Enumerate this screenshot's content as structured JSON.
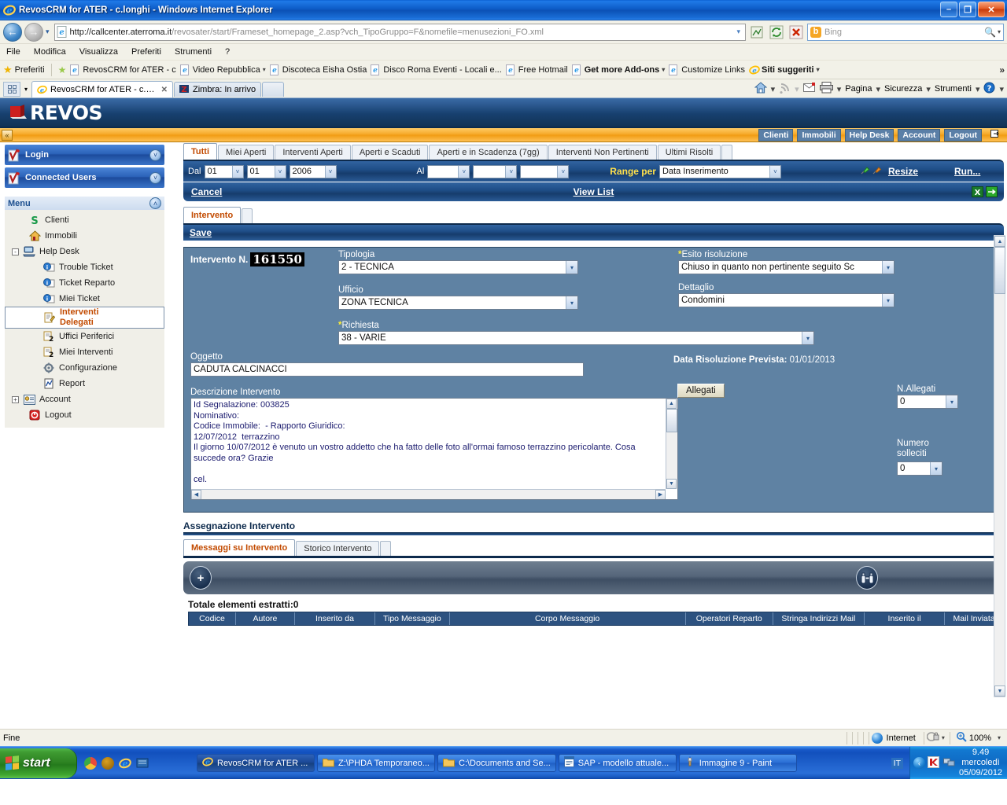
{
  "window": {
    "title": "RevosCRM for ATER - c.longhi - Windows Internet Explorer",
    "minimize": "–",
    "maximize": "❐",
    "close": "✕"
  },
  "address": {
    "back_icon": "←",
    "forward_icon": "→",
    "history_caret": "▾",
    "url_bold": "http://callcenter.aterroma.it",
    "url_rest": "/revosater/start/Frameset_homepage_2.asp?vch_TipoGruppo=F&nomefile=menusezioni_FO.xml",
    "url_caret": "▾",
    "compat_icon": "compatibility-view-icon",
    "refresh_icon": "↻",
    "stop_icon": "✕",
    "search_engine": "Bing",
    "search_placeholder": "Bing",
    "search_icon": "🔍",
    "search_caret": "▾"
  },
  "menubar": [
    "File",
    "Modifica",
    "Visualizza",
    "Preferiti",
    "Strumenti",
    "?"
  ],
  "favbar": {
    "label": "Preferiti",
    "items": [
      {
        "label": "RevosCRM for ATER - c",
        "caret": false,
        "bold": false
      },
      {
        "label": "Video Repubblica",
        "caret": true,
        "bold": false
      },
      {
        "label": "Discoteca Eisha Ostia",
        "caret": false,
        "bold": false
      },
      {
        "label": "Disco Roma Eventi - Locali e...",
        "caret": false,
        "bold": false
      },
      {
        "label": "Free Hotmail",
        "caret": false,
        "bold": false
      },
      {
        "label": "Get more Add-ons",
        "caret": true,
        "bold": true
      },
      {
        "label": "Customize Links",
        "caret": false,
        "bold": false
      },
      {
        "label": "Siti suggeriti",
        "caret": true,
        "bold": true
      }
    ],
    "overflow": "»"
  },
  "browser_tabs": {
    "quicktabs_caret": "▾",
    "tabs": [
      {
        "label": "RevosCRM for ATER - c.l...",
        "active": true,
        "close": "✕"
      },
      {
        "label": "Zimbra: In arrivo",
        "active": false,
        "close": ""
      }
    ],
    "command_bar": [
      "Pagina",
      "Sicurezza",
      "Strumenti"
    ],
    "overflow": "»"
  },
  "app": {
    "brand": "REVOS",
    "collapse_icon": "«",
    "topnav": [
      "Clienti",
      "Immobili",
      "Help Desk",
      "Account",
      "Logout"
    ]
  },
  "sidebar": {
    "panels": [
      {
        "title": "Login",
        "toggle": "˅"
      },
      {
        "title": "Connected Users",
        "toggle": "˅"
      }
    ],
    "menu_title": "Menu",
    "menu_toggle": "˄",
    "items": [
      {
        "label": "Clienti",
        "icon": "clienti-icon",
        "indent": 1,
        "expander": "",
        "selected": false
      },
      {
        "label": "Immobili",
        "icon": "immobili-icon",
        "indent": 1,
        "expander": "",
        "selected": false
      },
      {
        "label": "Help Desk",
        "icon": "helpdesk-icon",
        "indent": 0,
        "expander": "-",
        "selected": false
      },
      {
        "label": "Trouble Ticket",
        "icon": "ticket-icon",
        "indent": 2,
        "expander": "",
        "selected": false
      },
      {
        "label": "Ticket Reparto",
        "icon": "ticket-icon",
        "indent": 2,
        "expander": "",
        "selected": false
      },
      {
        "label": "Miei Ticket",
        "icon": "ticket-icon",
        "indent": 2,
        "expander": "",
        "selected": false
      },
      {
        "label": "Interventi Delegati",
        "icon": "interventi-icon",
        "indent": 2,
        "expander": "",
        "selected": true
      },
      {
        "label": "Uffici Periferici",
        "icon": "uffici-icon",
        "indent": 2,
        "expander": "",
        "selected": false
      },
      {
        "label": "Miei Interventi",
        "icon": "uffici-icon",
        "indent": 2,
        "expander": "",
        "selected": false
      },
      {
        "label": "Configurazione",
        "icon": "gear-icon",
        "indent": 2,
        "expander": "",
        "selected": false
      },
      {
        "label": "Report",
        "icon": "report-icon",
        "indent": 2,
        "expander": "",
        "selected": false
      },
      {
        "label": "Account",
        "icon": "account-icon",
        "indent": 0,
        "expander": "+",
        "selected": false
      },
      {
        "label": "Logout",
        "icon": "logout-icon",
        "indent": 1,
        "expander": "",
        "selected": false
      }
    ]
  },
  "filter_tabs": [
    {
      "label": "Tutti",
      "active": true
    },
    {
      "label": "Miei Aperti",
      "active": false
    },
    {
      "label": "Interventi Aperti",
      "active": false
    },
    {
      "label": "Aperti e Scaduti",
      "active": false
    },
    {
      "label": "Aperti e in Scadenza (7gg)",
      "active": false
    },
    {
      "label": "Interventi Non Pertinenti",
      "active": false
    },
    {
      "label": "Ultimi Risolti",
      "active": false
    }
  ],
  "filter_bar": {
    "dal_label": "Dal",
    "dal_day": "01",
    "dal_month": "01",
    "dal_year": "2006",
    "al_label": "Al",
    "al_day": "",
    "al_month": "",
    "al_year": "",
    "range_label": "Range per",
    "range_value": "Data Inserimento",
    "resize_label": "Resize",
    "run_label": "Run...",
    "caret": "˅"
  },
  "action_bar": {
    "cancel_label": "Cancel",
    "view_list_label": "View List",
    "excel_icon": "excel-export-icon",
    "arrow_icon": "→"
  },
  "form": {
    "tab_label": "Intervento",
    "save_label": "Save",
    "intervento_label": "Intervento N.",
    "intervento_number": "161550",
    "tipologia_label": "Tipologia",
    "tipologia_value": "2 - TECNICA",
    "ufficio_label": "Ufficio",
    "ufficio_value": "ZONA TECNICA",
    "richiesta_label": "Richiesta",
    "richiesta_value": "38 - VARIE",
    "esito_label": "Esito risoluzione",
    "esito_value": "Chiuso in quanto non pertinente seguito Sc",
    "dettaglio_label": "Dettaglio",
    "dettaglio_value": "Condomini",
    "data_risoluzione_label": "Data Risoluzione Prevista:",
    "data_risoluzione_value": "01/01/2013",
    "oggetto_label": "Oggetto",
    "oggetto_value": "CADUTA CALCINACCI",
    "descrizione_label": "Descrizione Intervento",
    "descrizione_value": "Id Segnalazione: 003825\nNominativo:\nCodice Immobile:  - Rapporto Giuridico:\n12/07/2012  terrazzino\nIl giorno 10/07/2012 è venuto un vostro addetto che ha fatto delle foto all'ormai famoso terrazzino pericolante. Cosa succede ora? Grazie\n\ncel.",
    "allegati_button": "Allegati",
    "n_allegati_label": "N.Allegati",
    "n_allegati_value": "0",
    "numero_solleciti_label": "Numero solleciti",
    "numero_solleciti_value": "0",
    "required_marker": "*"
  },
  "assignment": {
    "title": "Assegnazione Intervento",
    "tabs": [
      {
        "label": "Messaggi su Intervento",
        "active": true
      },
      {
        "label": "Storico Intervento",
        "active": false
      }
    ],
    "add_button": "+",
    "tool_button": "binoculars-icon",
    "total_label": "Totale elementi estratti:0",
    "columns": [
      "Codice",
      "Autore",
      "Inserito da",
      "Tipo Messaggio",
      "Corpo Messaggio",
      "Operatori Reparto",
      "Stringa Indirizzi Mail",
      "Inserito il",
      "Mail Inviata"
    ]
  },
  "statusbar": {
    "text": "Fine",
    "zone": "Internet",
    "zoom": "100%",
    "zoom_caret": "▾",
    "privacy_caret": "▾"
  },
  "taskbar": {
    "start_label": "start",
    "tasks": [
      {
        "label": "RevosCRM for ATER ...",
        "icon": "ie-icon",
        "active": true
      },
      {
        "label": "Z:\\PHDA Temporaneo...",
        "icon": "folder-icon",
        "active": false
      },
      {
        "label": "C:\\Documents and Se...",
        "icon": "folder-icon",
        "active": false
      },
      {
        "label": "SAP - modello attuale...",
        "icon": "doc-icon",
        "active": false
      },
      {
        "label": "Immagine 9 - Paint",
        "icon": "paint-icon",
        "active": false
      }
    ],
    "lang": "IT",
    "tray_arrow": "‹",
    "clock_time": "9.49",
    "clock_day": "mercoledì",
    "clock_date": "05/09/2012"
  },
  "colors": {
    "accent_blue": "#1f4e88",
    "orange": "#f5a623",
    "panel_blue": "#5f82a3",
    "selected_menu": "#c24a00"
  }
}
